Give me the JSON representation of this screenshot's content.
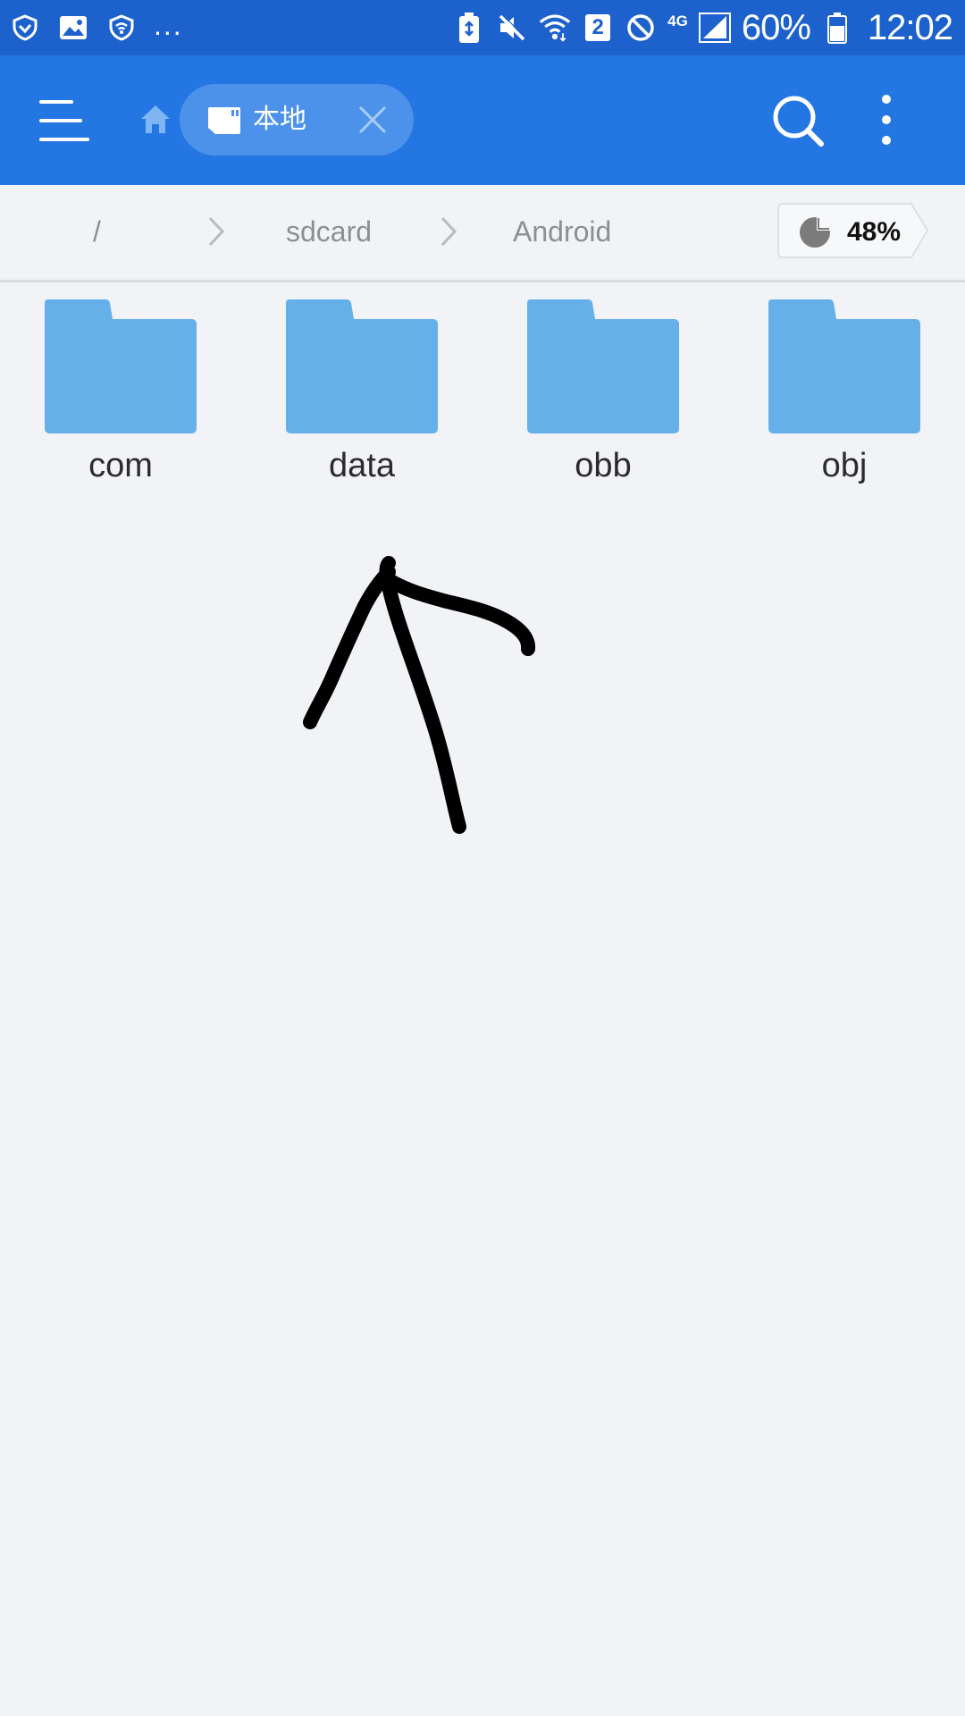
{
  "status_bar": {
    "battery_percent": "60%",
    "time": "12:02",
    "network_type": "4G",
    "sim_slot": "2",
    "notification_more": "..."
  },
  "app_bar": {
    "tab_label": "本地"
  },
  "breadcrumb": {
    "items": [
      "/",
      "sdcard",
      "Android"
    ],
    "storage_used": "48%"
  },
  "folders": [
    {
      "name": "com"
    },
    {
      "name": "data"
    },
    {
      "name": "obb"
    },
    {
      "name": "obj"
    }
  ],
  "colors": {
    "status_bar_bg": "#1d62cc",
    "app_bar_bg": "#2477e2",
    "tab_chip_bg": "#4c92ea",
    "folder_color": "#66b0ea",
    "background": "#f1f3f6"
  }
}
